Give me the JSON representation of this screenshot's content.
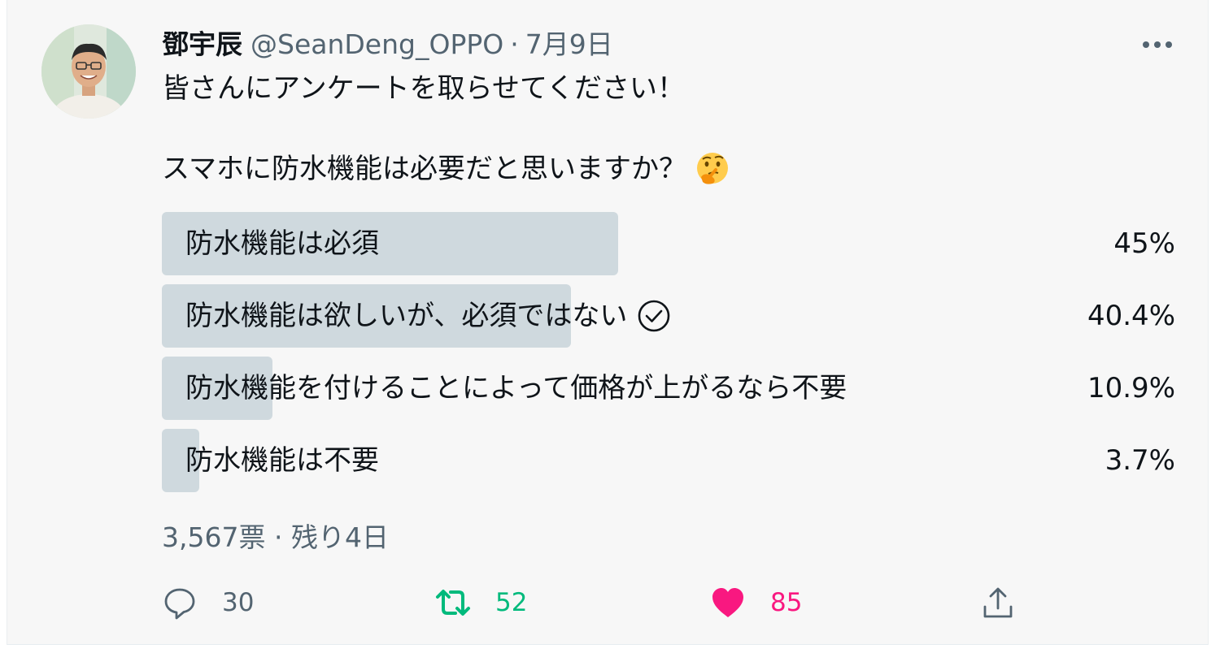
{
  "author": {
    "name": "鄧宇辰",
    "handle": "@SeanDeng_OPPO",
    "separator": "·",
    "date": "7月9日"
  },
  "tweet": {
    "line1": "皆さんにアンケートを取らせてください！",
    "line2": "スマホに防水機能は必要だと思いますか？",
    "emoji": "thinking-face-icon"
  },
  "poll": {
    "options": [
      {
        "label": "防水機能は必須",
        "percent_text": "45%",
        "percent": 45,
        "voted": false
      },
      {
        "label": "防水機能は欲しいが、必須ではない",
        "percent_text": "40.4%",
        "percent": 40.4,
        "voted": true
      },
      {
        "label": "防水機能を付けることによって価格が上がるなら不要",
        "percent_text": "10.9%",
        "percent": 10.9,
        "voted": false
      },
      {
        "label": "防水機能は不要",
        "percent_text": "3.7%",
        "percent": 3.7,
        "voted": false
      }
    ],
    "votes": "3,567票",
    "separator": "·",
    "remaining": "残り4日"
  },
  "actions": {
    "reply_count": "30",
    "retweet_count": "52",
    "like_count": "85",
    "liked": true
  },
  "colors": {
    "bar": "#cfd9de",
    "muted": "#536471",
    "retweet": "#00ba7c",
    "like": "#f91880"
  }
}
